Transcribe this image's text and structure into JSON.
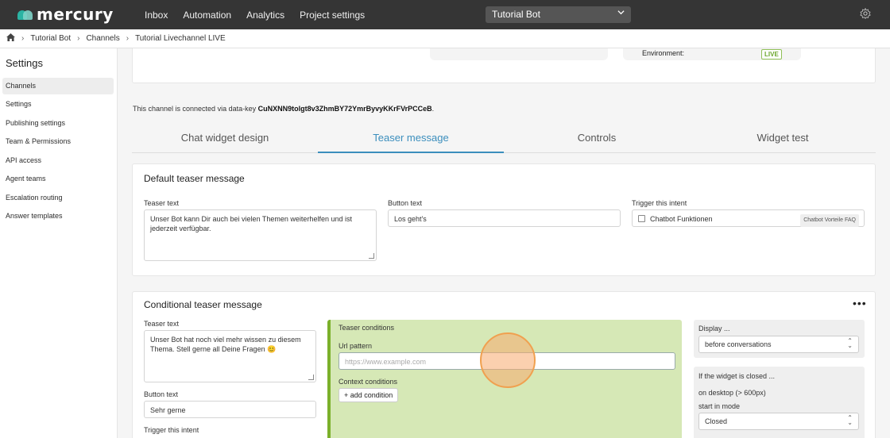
{
  "app": {
    "logo_text": "mercury"
  },
  "topnav": [
    "Inbox",
    "Automation",
    "Analytics",
    "Project settings"
  ],
  "project_select": {
    "value": "Tutorial Bot"
  },
  "breadcrumb": [
    "Tutorial Bot",
    "Channels",
    "Tutorial Livechannel LIVE"
  ],
  "sidebar": {
    "title": "Settings",
    "items": [
      {
        "label": "Channels",
        "active": true
      },
      {
        "label": "Settings"
      },
      {
        "label": "Publishing settings"
      },
      {
        "label": "Team & Permissions"
      },
      {
        "label": "API access"
      },
      {
        "label": "Agent teams"
      },
      {
        "label": "Escalation routing"
      },
      {
        "label": "Answer templates"
      }
    ]
  },
  "environment": {
    "label": "Environment:",
    "badge": "LIVE"
  },
  "datakey": {
    "prefix": "This channel is connected via data-key ",
    "key": "CuNXNN9tolgt8v3ZhmBY72YmrByvyKKrFVrPCCeB",
    "suffix": "."
  },
  "tabs": [
    "Chat widget design",
    "Teaser message",
    "Controls",
    "Widget test"
  ],
  "default_teaser": {
    "title": "Default teaser message",
    "teaser_label": "Teaser text",
    "teaser_value": "Unser Bot kann Dir auch bei vielen Themen weiterhelfen und ist jederzeit  verfügbar.",
    "button_label": "Button text",
    "button_value": "Los geht's",
    "intent_label": "Trigger this intent",
    "intent_value": "Chatbot Funktionen",
    "intent_tag": "Chatbot Vorteile FAQ"
  },
  "conditional_teaser": {
    "title": "Conditional teaser message",
    "menu": "•••",
    "teaser_label": "Teaser text",
    "teaser_value": "Unser Bot hat noch viel mehr wissen zu diesem Thema. Stell gerne all Deine Fragen 😊",
    "button_label": "Button text",
    "button_value": "Sehr gerne",
    "intent_label": "Trigger this intent",
    "conditions_title": "Teaser conditions",
    "url_label": "Url pattern",
    "url_placeholder": "https://www.example.com",
    "context_label": "Context conditions",
    "add_condition": "+ add condition",
    "display_label": "Display ...",
    "display_value": "before conversations",
    "closed_title": "If the widget is closed ...",
    "desktop_label": "on desktop (> 600px)",
    "start_mode_label": "start in mode",
    "start_mode_value": "Closed"
  },
  "colors": {
    "accent": "#3b8ebd",
    "topbar": "#353535",
    "conditions_bg": "#d6e8b6",
    "conditions_border": "#7bb02a",
    "live": "#6aa52a"
  }
}
